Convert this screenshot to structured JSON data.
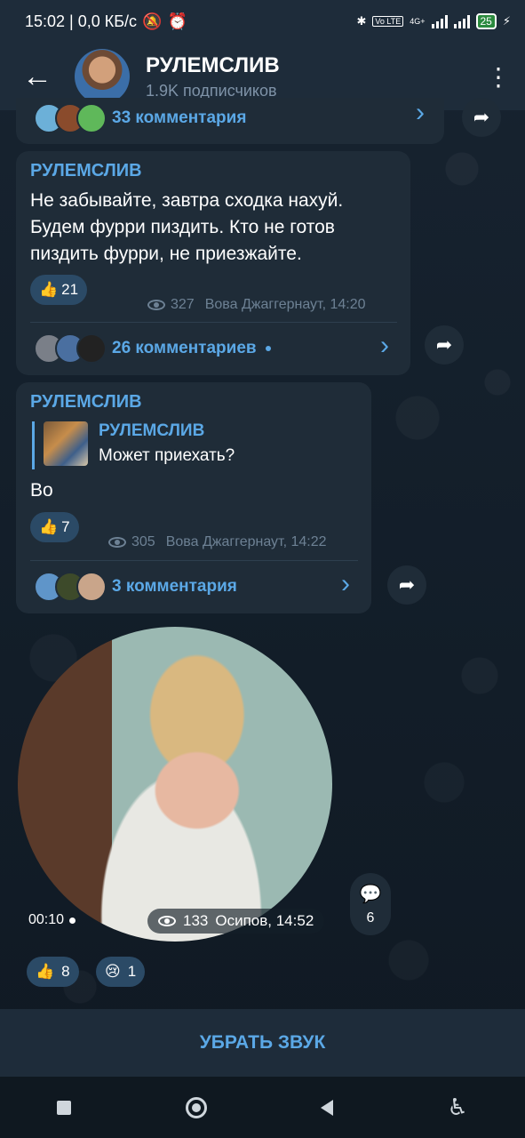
{
  "status_bar": {
    "time_and_speed": "15:02 | 0,0 КБ/с",
    "network": "4G+",
    "volte": "Vo LTE",
    "battery": "25"
  },
  "header": {
    "title": "РУЛЕМСЛИВ",
    "subtitle": "1.9K подписчиков"
  },
  "messages": [
    {
      "comments_label": "33 комментария"
    },
    {
      "author": "РУЛЕМСЛИВ",
      "text": "Не забывайте, завтра сходка нахуй. Будем фурри пиздить. Кто не готов пиздить фурри, не приезжайте.",
      "reaction_emoji": "👍",
      "reaction_count": "21",
      "views": "327",
      "signature": "Вова Джаггернаут, 14:20",
      "comments_label": "26 комментариев"
    },
    {
      "author": "РУЛЕМСЛИВ",
      "quote_author": "РУЛЕМСЛИВ",
      "quote_text": "Может приехать?",
      "text": "Во",
      "reaction_emoji": "👍",
      "reaction_count": "7",
      "views": "305",
      "signature": "Вова Джаггернаут, 14:22",
      "comments_label": "3 комментария"
    },
    {
      "duration": "00:10",
      "views": "133",
      "signature": "Осипов, 14:52",
      "comments_count": "6",
      "reactions": [
        {
          "emoji": "👍",
          "count": "8"
        },
        {
          "emoji": "😢",
          "count": "1"
        }
      ]
    }
  ],
  "mute_button": "УБРАТЬ ЗВУК",
  "icons": {
    "back": "←",
    "menu": "⋮",
    "chevron": "›",
    "share": "➦",
    "comment": "💬"
  },
  "colors": {
    "accent": "#5ba8e6",
    "bubble": "#1f2c38",
    "header": "#1e2c3a"
  }
}
